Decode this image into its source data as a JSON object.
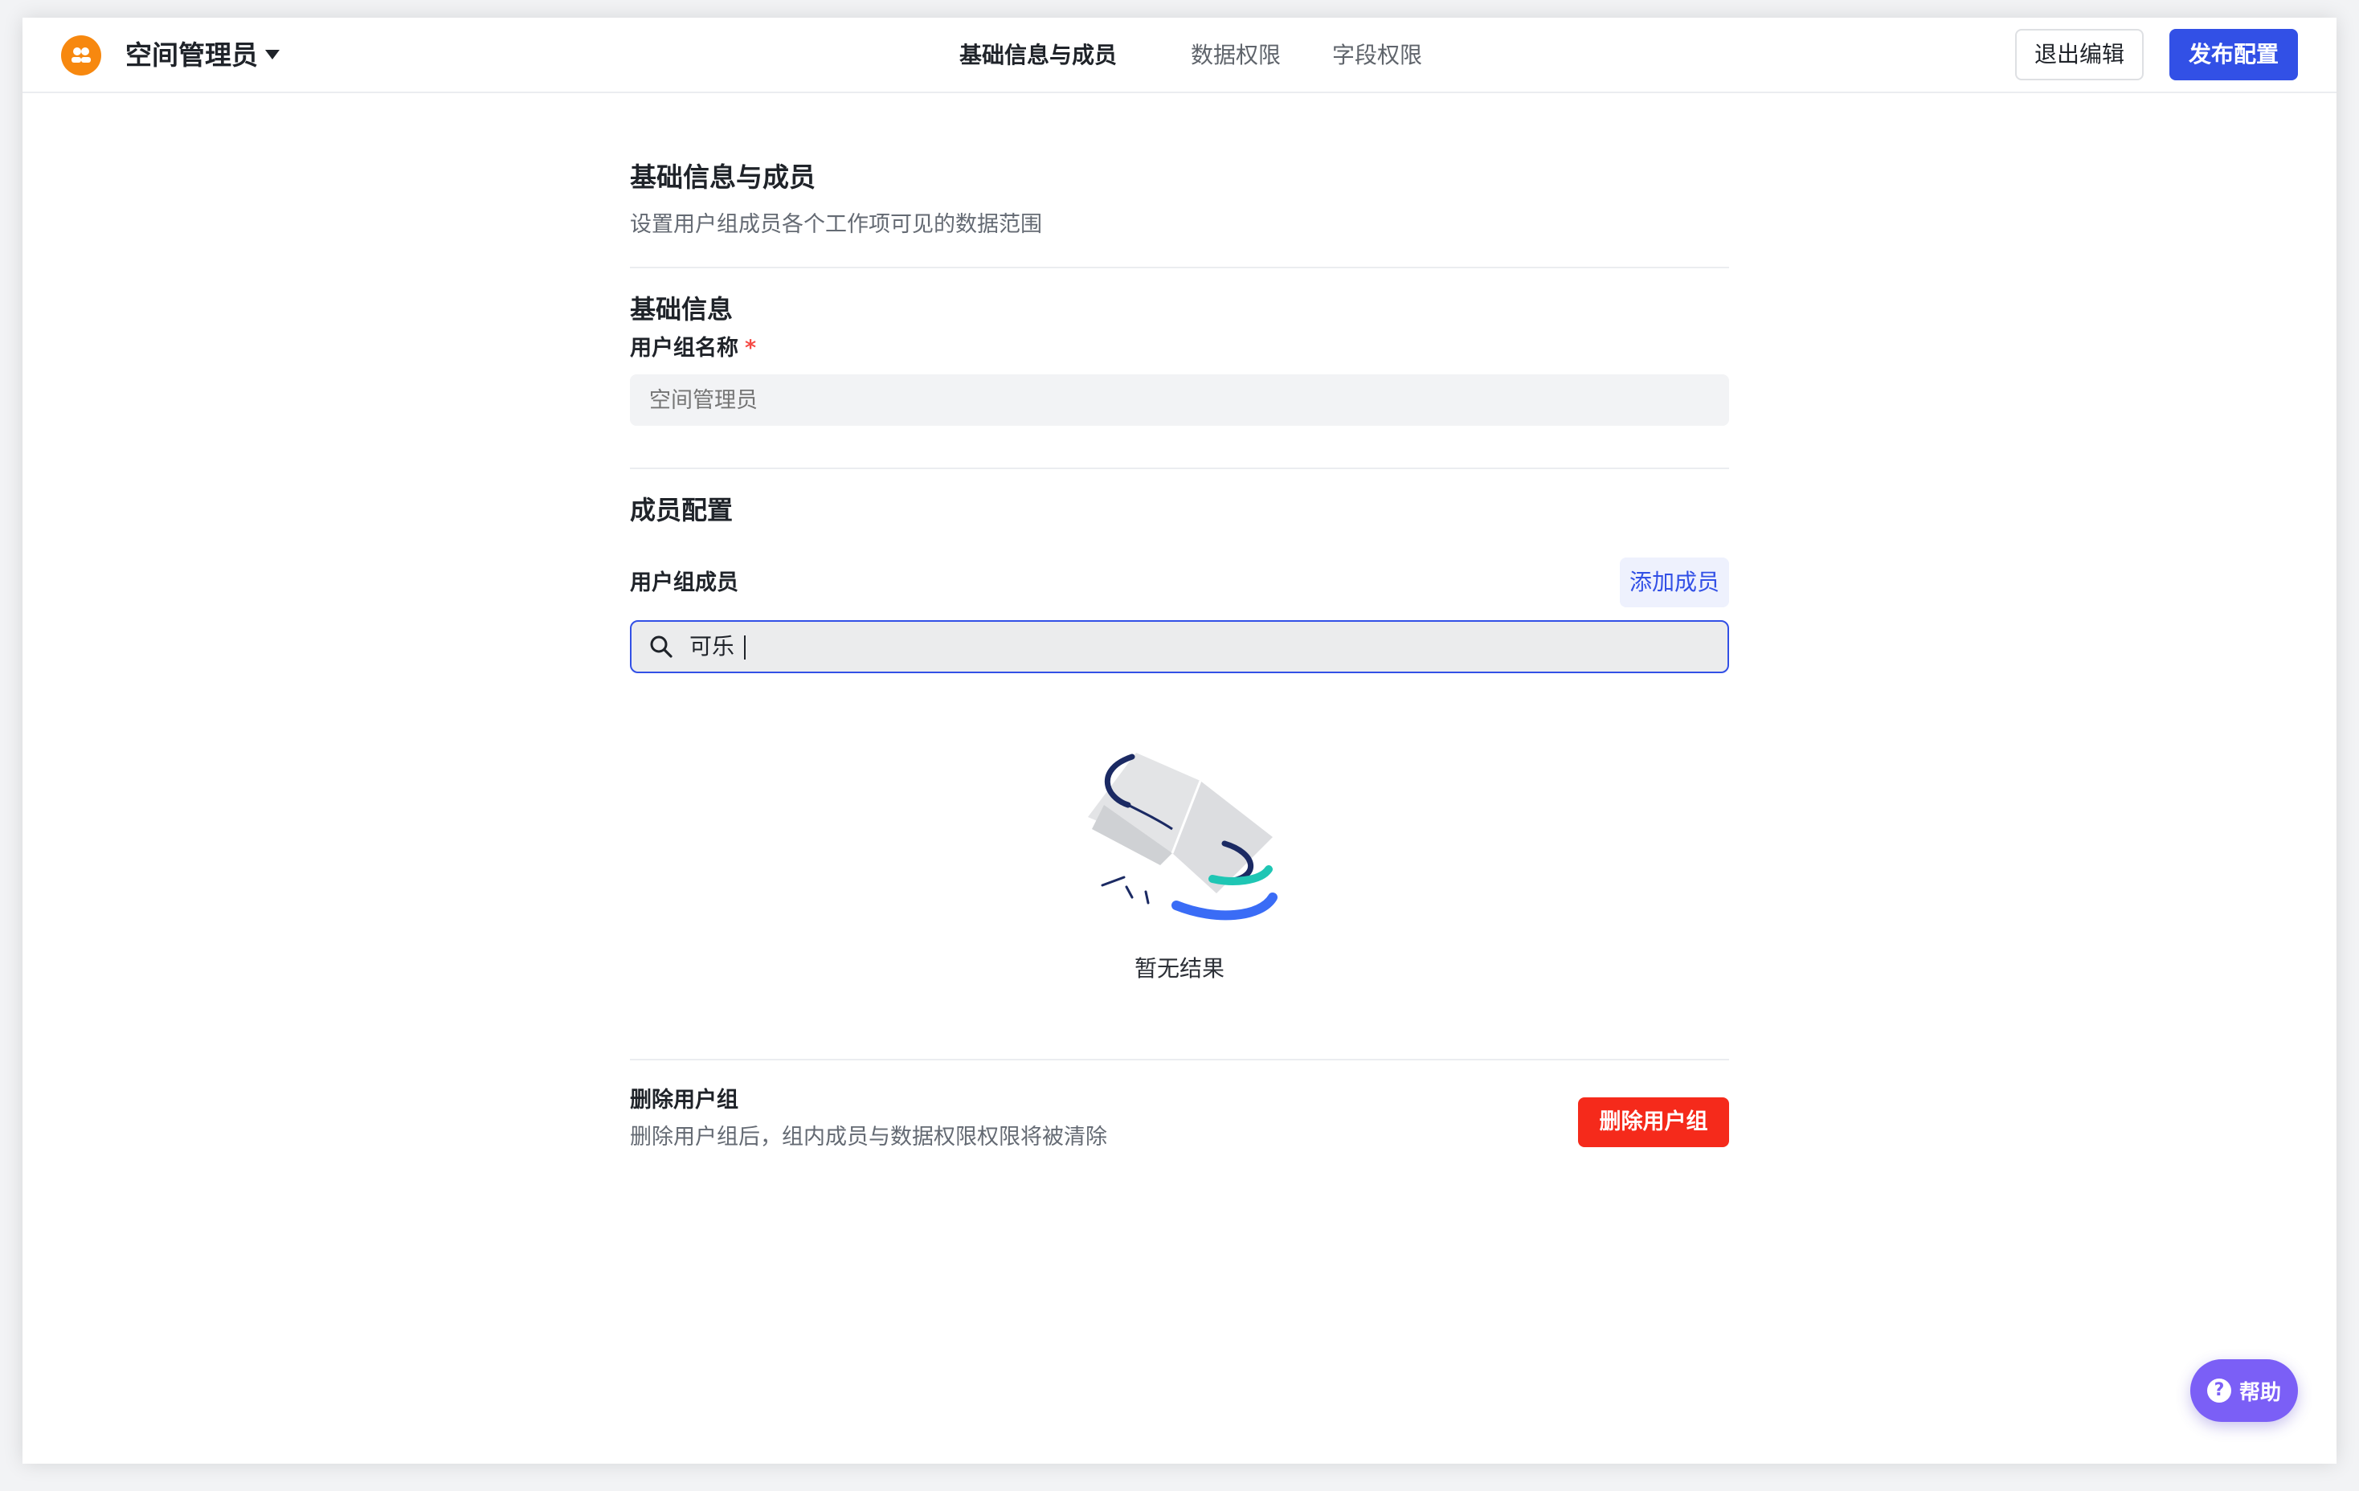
{
  "header": {
    "space_title": "空间管理员",
    "tabs": [
      {
        "label": "基础信息与成员",
        "active": true
      },
      {
        "label": "数据权限",
        "active": false
      },
      {
        "label": "字段权限",
        "active": false
      }
    ],
    "exit_label": "退出编辑",
    "publish_label": "发布配置"
  },
  "main": {
    "title": "基础信息与成员",
    "subtitle": "设置用户组成员各个工作项可见的数据范围",
    "basic_section": {
      "title": "基础信息",
      "name_label": "用户组名称",
      "required_mark": "*",
      "name_placeholder": "空间管理员"
    },
    "member_section": {
      "title": "成员配置",
      "members_label": "用户组成员",
      "add_label": "添加成员",
      "search_value": "可乐",
      "empty_text": "暂无结果"
    },
    "delete_section": {
      "title": "删除用户组",
      "description": "删除用户组后，组内成员与数据权限权限将被清除",
      "button_label": "删除用户组"
    }
  },
  "help": {
    "icon": "?",
    "label": "帮助"
  },
  "colors": {
    "primary": "#3250e6",
    "danger": "#f52a1b",
    "logo": "#f7880f",
    "help": "#7b5ff6"
  }
}
